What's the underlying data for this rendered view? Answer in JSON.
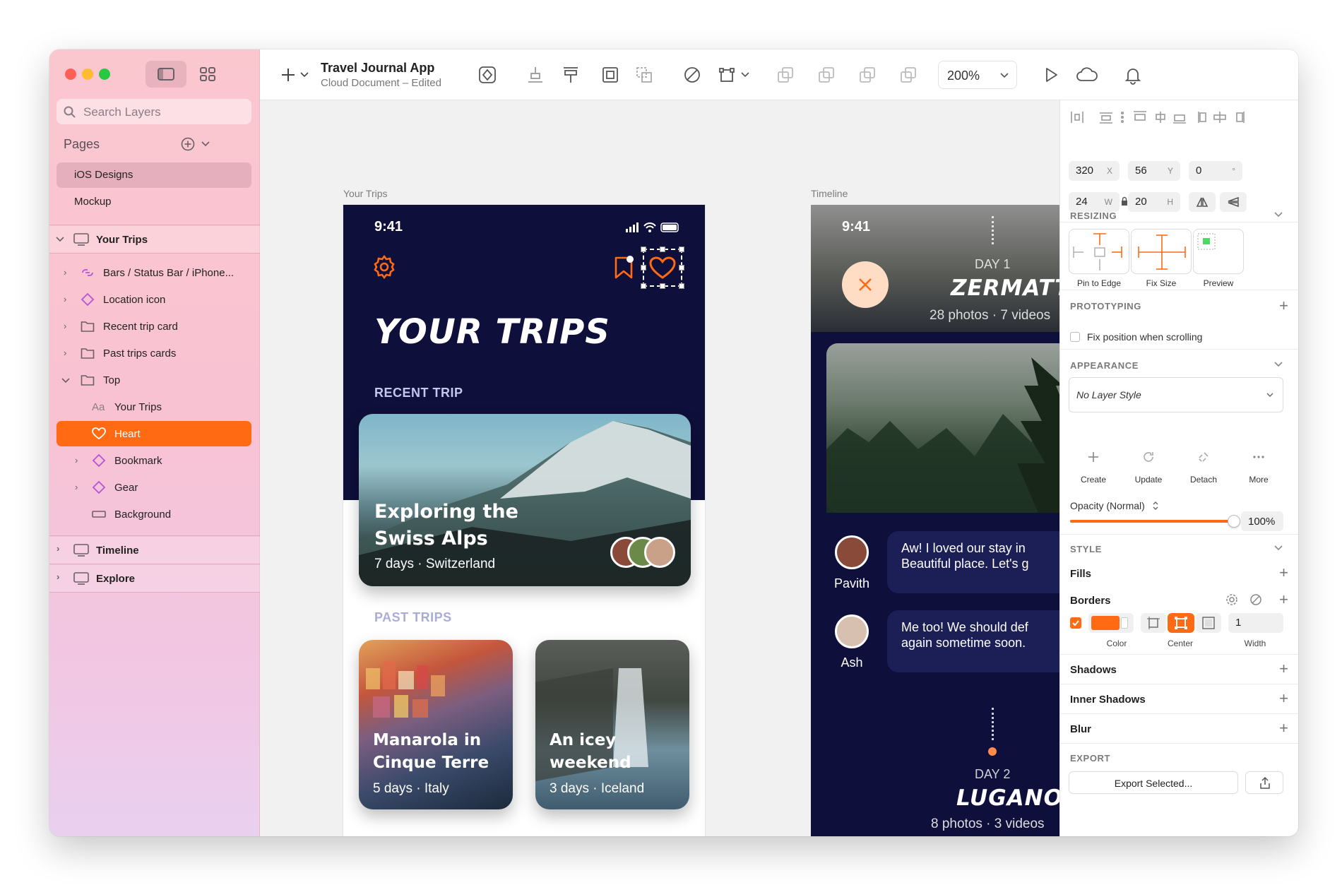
{
  "app": {
    "title": "Travel Journal App",
    "subtitle": "Cloud Document – Edited",
    "zoom": "200%"
  },
  "sidebar": {
    "search_placeholder": "Search Layers",
    "pages_label": "Pages",
    "pages": [
      "iOS Designs",
      "Mockup"
    ],
    "groups": {
      "your_trips": "Your Trips",
      "timeline": "Timeline",
      "explore": "Explore"
    },
    "layers": [
      {
        "label": "Bars / Status Bar / iPhone...",
        "icon": "symbol-link-icon"
      },
      {
        "label": "Location icon",
        "icon": "symbol-diamond-icon"
      },
      {
        "label": "Recent trip card",
        "icon": "folder-icon"
      },
      {
        "label": "Past trips cards",
        "icon": "folder-icon"
      },
      {
        "label": "Top",
        "icon": "folder-icon"
      },
      {
        "label": "Your Trips",
        "icon": "text-icon"
      },
      {
        "label": "Heart",
        "icon": "heart-icon",
        "selected": true
      },
      {
        "label": "Bookmark",
        "icon": "symbol-diamond-icon"
      },
      {
        "label": "Gear",
        "icon": "symbol-diamond-icon"
      },
      {
        "label": "Background",
        "icon": "rectangle-icon"
      }
    ],
    "text_icon_glyph": "Aa"
  },
  "canvas": {
    "artboard1": {
      "label": "Your Trips",
      "time": "9:41",
      "title": "YOUR TRIPS",
      "recent_label": "RECENT TRIP",
      "recent_card": {
        "title_line1": "Exploring the",
        "title_line2": "Swiss Alps",
        "subtitle": "7 days · Switzerland"
      },
      "past_label": "PAST TRIPS",
      "past_cards": [
        {
          "title_line1": "Manarola in",
          "title_line2": "Cinque Terre",
          "subtitle": "5 days · Italy"
        },
        {
          "title_line1": "An icey",
          "title_line2": "weekend",
          "subtitle": "3 days · Iceland"
        }
      ]
    },
    "artboard2": {
      "label": "Timeline",
      "time": "9:41",
      "day1": "DAY 1",
      "place1": "ZERMATT",
      "meta1": "28 photos · 7 videos",
      "messages": [
        {
          "name": "Pavith",
          "line1": "Aw! I loved our stay in",
          "line2": "Beautiful place. Let's g"
        },
        {
          "name": "Ash",
          "line1": "Me too! We should def",
          "line2": "again sometime soon."
        }
      ],
      "day2": "DAY 2",
      "place2": "LUGANO",
      "meta2": "8 photos · 3 videos"
    }
  },
  "inspector": {
    "x": "320",
    "x_unit": "X",
    "y": "56",
    "y_unit": "Y",
    "rotation": "0",
    "rotation_unit": "°",
    "w": "24",
    "w_unit": "W",
    "h": "20",
    "h_unit": "H",
    "resizing": {
      "header": "RESIZING",
      "options": [
        "Pin to Edge",
        "Fix Size",
        "Preview"
      ]
    },
    "prototyping": {
      "header": "PROTOTYPING",
      "fix_position": "Fix position when scrolling"
    },
    "appearance": {
      "header": "APPEARANCE",
      "layer_style": "No Layer Style",
      "actions": [
        "Create",
        "Update",
        "Detach",
        "More"
      ],
      "opacity_label": "Opacity (Normal)",
      "opacity_value": "100%",
      "opacity_fraction": 1.0
    },
    "style": {
      "header": "STYLE",
      "fills": "Fills",
      "borders": "Borders",
      "border_color_label": "Color",
      "border_position_label": "Center",
      "border_width": "1",
      "border_width_label": "Width",
      "shadows": "Shadows",
      "inner_shadows": "Inner Shadows",
      "blur": "Blur"
    },
    "export": {
      "header": "EXPORT",
      "button": "Export Selected..."
    }
  },
  "colors": {
    "accent": "#ff6a13",
    "navy": "#0e0f3b",
    "selection": "#ff6a13",
    "peach": "#ffdcc4"
  }
}
